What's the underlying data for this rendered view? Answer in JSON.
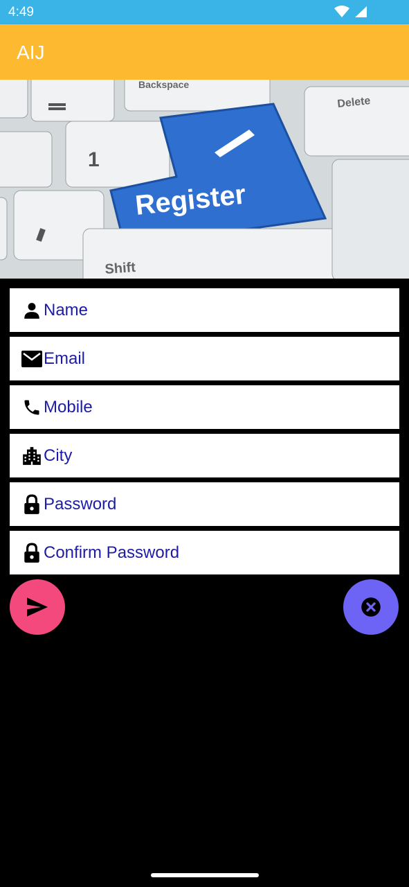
{
  "status_bar": {
    "time": "4:49",
    "icons": [
      "wifi-icon",
      "signal-icon"
    ]
  },
  "app_bar": {
    "title": "AIJ",
    "color": "#fdba30"
  },
  "hero": {
    "main_key": "Register",
    "key_labels": [
      "Backspace",
      "Delete",
      "Shift",
      "1"
    ]
  },
  "form": {
    "fields": [
      {
        "name": "name-field",
        "icon": "person-icon",
        "placeholder": "Name"
      },
      {
        "name": "email-field",
        "icon": "mail-icon",
        "placeholder": "Email"
      },
      {
        "name": "mobile-field",
        "icon": "phone-icon",
        "placeholder": "Mobile"
      },
      {
        "name": "city-field",
        "icon": "city-icon",
        "placeholder": "City"
      },
      {
        "name": "password-field",
        "icon": "lock-icon",
        "placeholder": "Password"
      },
      {
        "name": "confirm-password-field",
        "icon": "lock-icon",
        "placeholder": "Confirm Password"
      }
    ]
  },
  "actions": {
    "send": {
      "icon": "send-icon",
      "color": "#f4497d"
    },
    "cancel": {
      "icon": "cancel-icon",
      "color": "#6d63f4"
    }
  },
  "colors": {
    "status_bar": "#3ab4e6",
    "input_text": "#1c1ca8",
    "background": "#000000"
  }
}
